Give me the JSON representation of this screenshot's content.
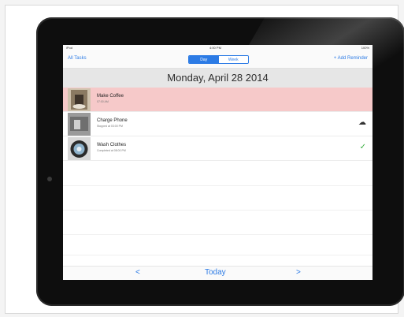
{
  "status_bar": {
    "carrier": "iPod",
    "time": "4:00 PM",
    "battery": "100%"
  },
  "nav": {
    "left_link": "All Tasks",
    "segments": [
      "Day",
      "Week"
    ],
    "selected_segment": "Day",
    "right_link": "+ Add Reminder"
  },
  "date_header": "Monday, April 28 2014",
  "tasks": [
    {
      "title": "Make Coffee",
      "subtitle": "07:00 AM",
      "status_icon": "",
      "highlighted": true
    },
    {
      "title": "Charge Phone",
      "subtitle": "Stopped at 03:00 PM",
      "status_icon": "☁",
      "highlighted": false
    },
    {
      "title": "Wash Clothes",
      "subtitle": "Completed at 08:00 PM",
      "status_icon": "✓",
      "highlighted": false
    }
  ],
  "bottom": {
    "prev": "<",
    "today": "Today",
    "next": ">"
  },
  "colors": {
    "accent": "#2c7be5",
    "highlight_row": "#f6c9c9",
    "check": "#3cb043"
  }
}
